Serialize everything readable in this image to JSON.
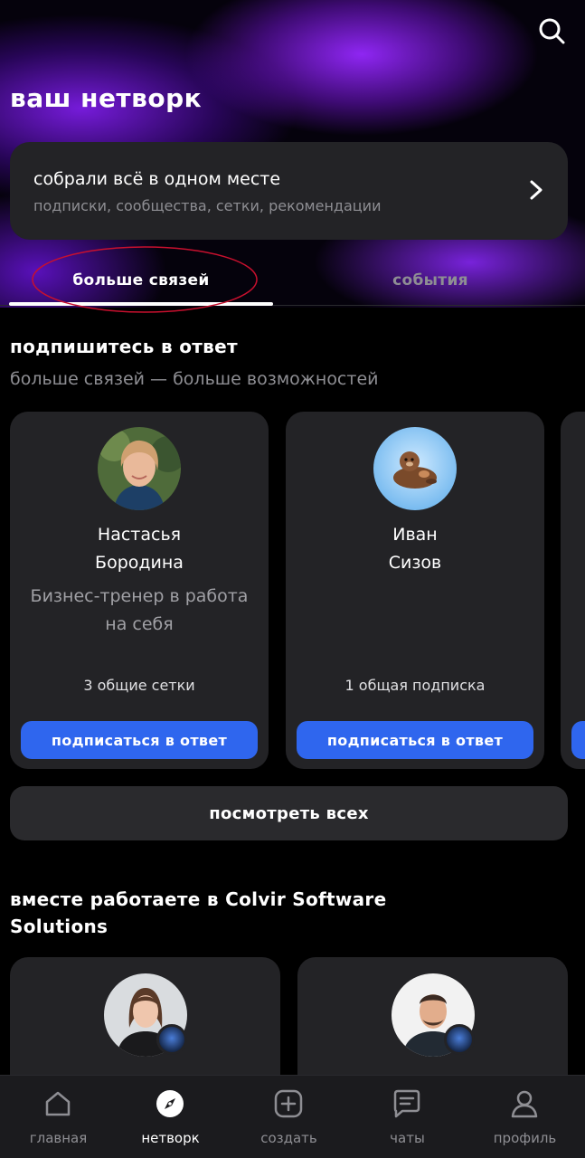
{
  "header": {
    "title": "ваш нетворк",
    "search_icon": "search-icon"
  },
  "collect_card": {
    "title": "собрали всё в одном месте",
    "subtitle": "подписки, сообщества, сетки, рекомендации"
  },
  "tabs": [
    {
      "label": "больше связей",
      "active": true
    },
    {
      "label": "события",
      "active": false
    }
  ],
  "follow_back": {
    "title": "подпишитесь в ответ",
    "subtitle": "больше связей — больше возможностей",
    "people": [
      {
        "first_name": "Настасья",
        "last_name": "Бородина",
        "role": "Бизнес-тренер в работа на себя",
        "common": "3 общие сетки",
        "button": "подписаться в ответ"
      },
      {
        "first_name": "Иван",
        "last_name": "Сизов",
        "role": "",
        "common": "1 общая подписка",
        "button": "подписаться в ответ"
      }
    ],
    "see_all": "посмотреть всех"
  },
  "coworkers": {
    "title_line1": "вместе работаете в  Colvir Software",
    "title_line2": "Solutions"
  },
  "bottom_nav": [
    {
      "label": "главная",
      "icon": "home-icon",
      "active": false
    },
    {
      "label": "нетворк",
      "icon": "compass-icon",
      "active": true
    },
    {
      "label": "создать",
      "icon": "plus-square-icon",
      "active": false
    },
    {
      "label": "чаты",
      "icon": "chat-icon",
      "active": false
    },
    {
      "label": "профиль",
      "icon": "user-icon",
      "active": false
    }
  ],
  "colors": {
    "accent": "#2f66ee",
    "card": "#232326",
    "annotation": "#c8102e"
  }
}
